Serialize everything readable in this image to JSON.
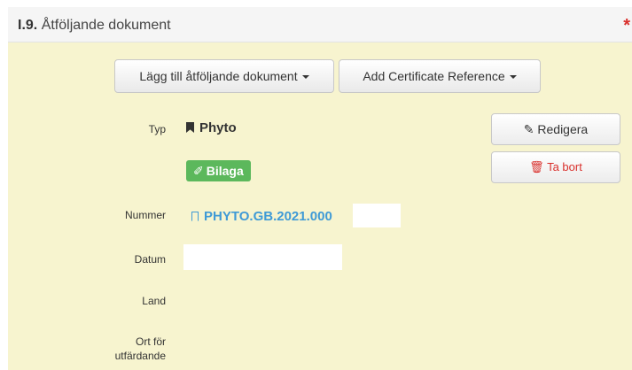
{
  "section": {
    "number": "I.9.",
    "title": "Åtföljande dokument",
    "required_mark": "*"
  },
  "toolbar": {
    "add_document_label": "Lägg till åtföljande dokument",
    "add_certificate_label": "Add Certificate Reference"
  },
  "fields": {
    "type_label": "Typ",
    "type_value": "Phyto",
    "attachment_badge": "Bilaga",
    "number_label": "Nummer",
    "number_value": "PHYTO.GB.2021.000",
    "date_label": "Datum",
    "country_label": "Land",
    "place_label_line1": "Ort för",
    "place_label_line2": "utfärdande"
  },
  "actions": {
    "edit_label": "Redigera",
    "delete_label": "Ta bort"
  },
  "colors": {
    "panel_bg": "#f7f4cf",
    "badge_green": "#5cb85c",
    "link_blue": "#3f9ad6",
    "danger_red": "#d9302c"
  }
}
